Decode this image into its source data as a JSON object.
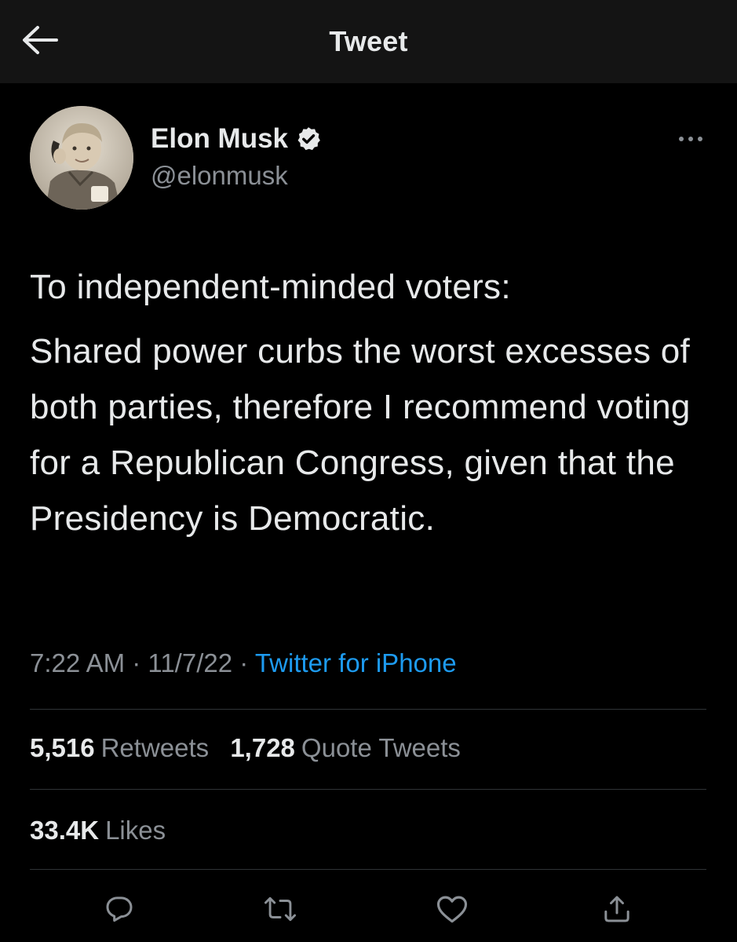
{
  "header": {
    "title": "Tweet"
  },
  "author": {
    "name": "Elon Musk",
    "handle": "@elonmusk"
  },
  "tweet": {
    "paragraphs": [
      "To independent-minded voters:",
      "Shared power curbs the worst excesses of both parties, therefore I recommend voting for a Republican Congress, given that the Presidency is Democratic."
    ],
    "time": "7:22 AM",
    "date": "11/7/22",
    "separator": "·",
    "source": "Twitter for iPhone"
  },
  "stats": {
    "retweets_count": "5,516",
    "retweets_label": "Retweets",
    "quotes_count": "1,728",
    "quotes_label": "Quote Tweets",
    "likes_count": "33.4K",
    "likes_label": "Likes"
  },
  "colors": {
    "background": "#000000",
    "header_background": "#141414",
    "primary_text": "#e7e9ea",
    "secondary_text": "#8b9096",
    "link": "#1d9bf0",
    "divider": "#2f3336"
  },
  "icons": {
    "back": "arrow-left-icon",
    "more": "more-horizontal-icon",
    "verified": "verified-badge-icon",
    "reply": "reply-icon",
    "retweet": "retweet-icon",
    "like": "heart-icon",
    "share": "share-icon"
  }
}
